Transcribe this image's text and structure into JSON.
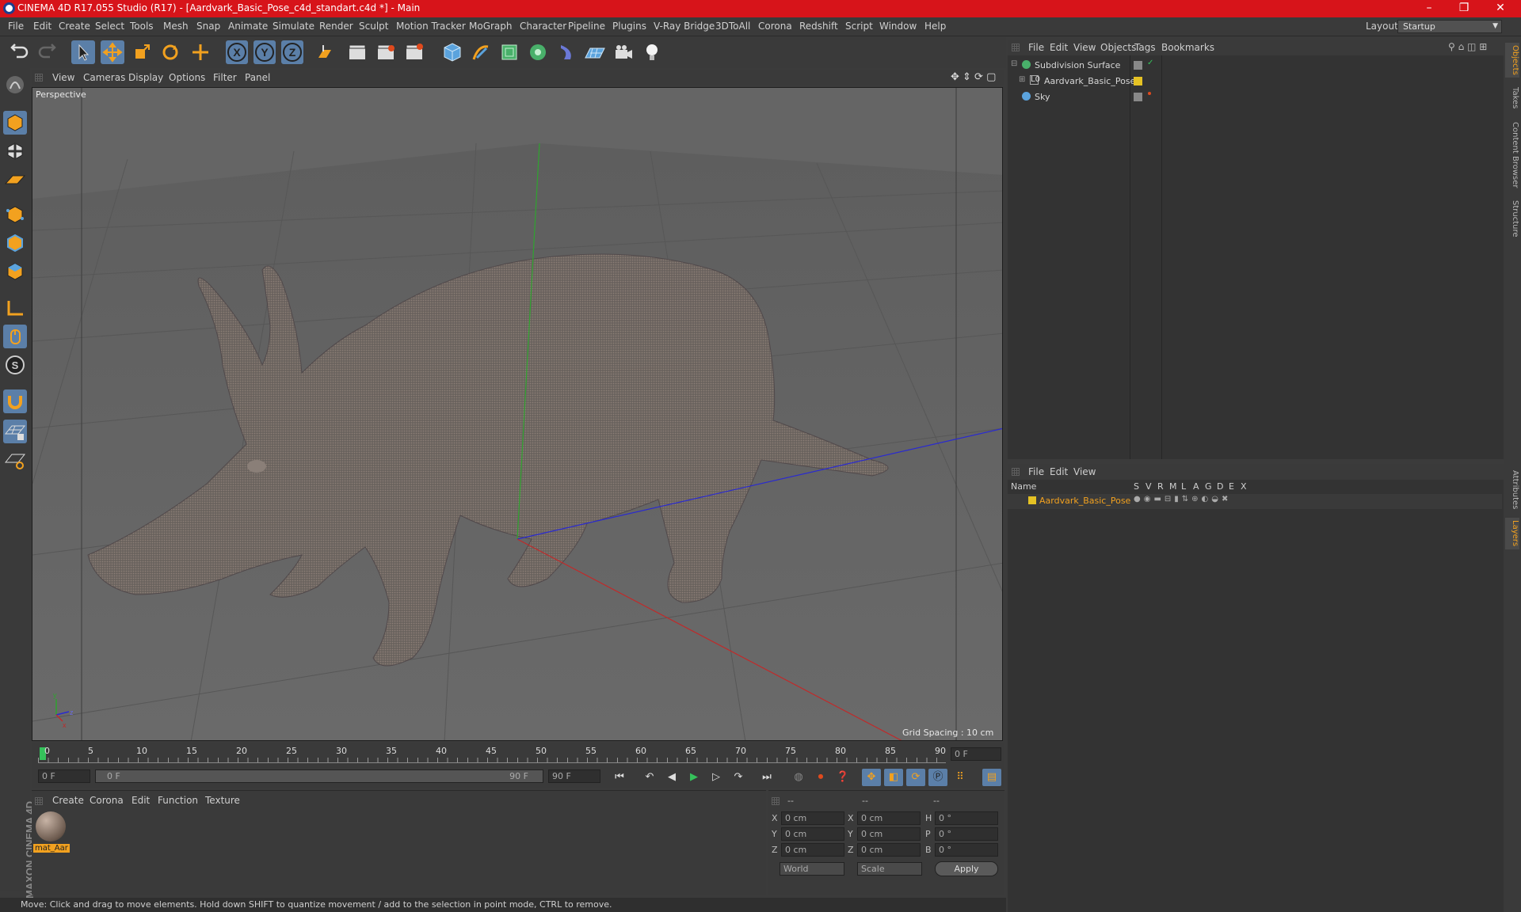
{
  "window": {
    "title": "CINEMA 4D R17.055 Studio (R17) - [Aardvark_Basic_Pose_c4d_standart.c4d *] - Main",
    "controls": [
      "–",
      "❐",
      "✕"
    ]
  },
  "menubar": {
    "items": [
      "File",
      "Edit",
      "Create",
      "Select",
      "Tools",
      "Mesh",
      "Snap",
      "Animate",
      "Simulate",
      "Render",
      "Sculpt",
      "Motion Tracker",
      "MoGraph",
      "Character",
      "Pipeline",
      "Plugins",
      "V-Ray Bridge",
      "3DToAll",
      "Corona",
      "Redshift",
      "Script",
      "Window",
      "Help"
    ],
    "layout_label": "Layout:",
    "layout_value": "Startup"
  },
  "toolbar": {
    "axis_x": "X",
    "axis_y": "Y",
    "axis_z": "Z"
  },
  "viewport": {
    "menu": [
      "View",
      "Cameras",
      "Display",
      "Options",
      "Filter",
      "Panel"
    ],
    "camera_label": "Perspective",
    "grid_spacing": "Grid Spacing : 10 cm"
  },
  "timeline": {
    "ticks": [
      "0",
      "5",
      "10",
      "15",
      "20",
      "25",
      "30",
      "35",
      "40",
      "45",
      "50",
      "55",
      "60",
      "65",
      "70",
      "75",
      "80",
      "85",
      "90"
    ],
    "current_frame": "0 F",
    "start_field": "0 F",
    "range_start": "0 F",
    "range_end": "90 F",
    "end_field": "90 F"
  },
  "material_panel": {
    "menu": [
      "Create",
      "Corona",
      "Edit",
      "Function",
      "Texture"
    ],
    "material_name": "mat_Aar"
  },
  "coordinates": {
    "header": [
      "--",
      "--",
      "--"
    ],
    "rows": [
      {
        "a": "X",
        "av": "0 cm",
        "b": "X",
        "bv": "0 cm",
        "c": "H",
        "cv": "0 °"
      },
      {
        "a": "Y",
        "av": "0 cm",
        "b": "Y",
        "bv": "0 cm",
        "c": "P",
        "cv": "0 °"
      },
      {
        "a": "Z",
        "av": "0 cm",
        "b": "Z",
        "bv": "0 cm",
        "c": "B",
        "cv": "0 °"
      }
    ],
    "mode_world": "World",
    "mode_scale": "Scale",
    "apply": "Apply"
  },
  "object_manager": {
    "menu": [
      "File",
      "Edit",
      "View",
      "Objects",
      "Tags",
      "Bookmarks"
    ],
    "objects": [
      {
        "name": "Subdivision Surface",
        "indent": 0
      },
      {
        "name": "Aardvark_Basic_Pose",
        "indent": 1
      },
      {
        "name": "Sky",
        "indent": 0
      }
    ]
  },
  "layer_manager": {
    "menu": [
      "File",
      "Edit",
      "View"
    ],
    "columns": [
      "Name",
      "S",
      "V",
      "R",
      "M",
      "L",
      "A",
      "G",
      "D",
      "E",
      "X"
    ],
    "layers": [
      {
        "name": "Aardvark_Basic_Pose",
        "color": "#e5c224"
      }
    ]
  },
  "right_tabs": [
    "Objects",
    "Takes",
    "Content Browser",
    "Structure",
    "Attributes",
    "Layers"
  ],
  "status_text": "Move: Click and drag to move elements. Hold down SHIFT to quantize movement / add to the selection in point mode, CTRL to remove.",
  "branding": "MAXON CINEMA 4D"
}
